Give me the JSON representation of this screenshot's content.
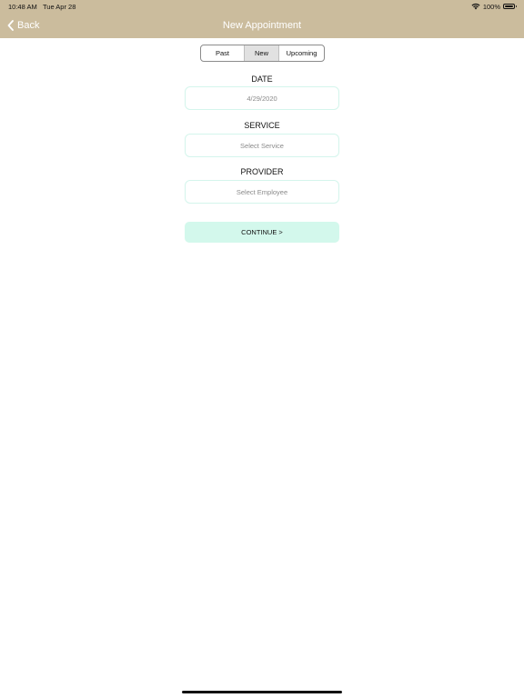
{
  "status_bar": {
    "time": "10:48 AM",
    "date": "Tue Apr 28",
    "battery": "100%",
    "icons": [
      "wifi-icon",
      "battery-icon"
    ]
  },
  "nav": {
    "back_label": "Back",
    "back_icon": "chevron-left-icon",
    "title": "New Appointment"
  },
  "tabs": {
    "past": "Past",
    "new": "New",
    "upcoming": "Upcoming",
    "selected": "New"
  },
  "form": {
    "date_label": "DATE",
    "date_value": "4/29/2020",
    "service_label": "SERVICE",
    "service_placeholder": "Select Service",
    "provider_label": "PROVIDER",
    "provider_placeholder": "Select Employee",
    "continue_label": "CONTINUE >"
  },
  "colors": {
    "nav_bar": "#cbbc9d",
    "field_border": "#d4f5ec",
    "continue_bg": "#d3f8ec",
    "selected_tab": "#e1e1e1"
  }
}
